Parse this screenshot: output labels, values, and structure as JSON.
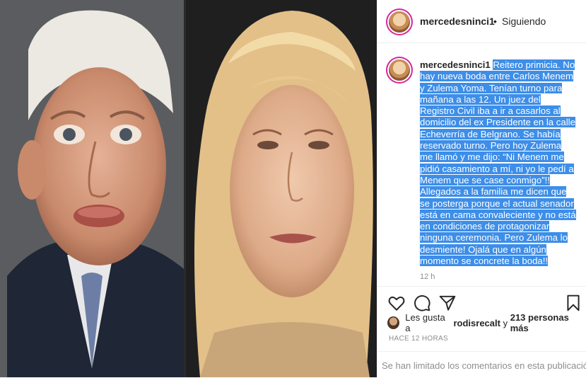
{
  "post": {
    "image_alt_left": "Carlos Menem",
    "image_alt_right": "Zulema Yoma"
  },
  "header": {
    "username": "mercedesninci1",
    "separator": "•",
    "follow_status": "Siguiendo"
  },
  "caption": {
    "username": "mercedesninci1",
    "text": "Reitero primicia. No hay nueva boda entre Carlos Menem y Zulema Yoma. Tenían turno para mañana a las 12. Un juez del Registro Civil iba a ir a casarlos al domicilio del ex Presidente en la calle Echeverría de Belgrano. Se había reservado turno. Pero hoy Zulema me llamó y me dijo: “Ni Menem me pidió casamiento a mí, ni yo le pedí a Menem que se case conmigo”!! Allegados a la familia me dicen que se posterga porque el actual senador está en cama convaleciente y no está en condiciones de protagonizar ninguna ceremonia. Pero Zulema lo desmiente! Ojalá que en algún momento se concrete la boda!!",
    "time": "12 h"
  },
  "actions": {
    "like": "heart-icon",
    "comment": "comment-icon",
    "share": "share-icon",
    "save": "bookmark-icon"
  },
  "likes": {
    "prefix": "Les gusta a",
    "user": "rodisrecalt",
    "middle": "y",
    "count": "213 personas más"
  },
  "date": "HACE 12 HORAS",
  "comments_notice": "Se han limitado los comentarios en esta publicación."
}
